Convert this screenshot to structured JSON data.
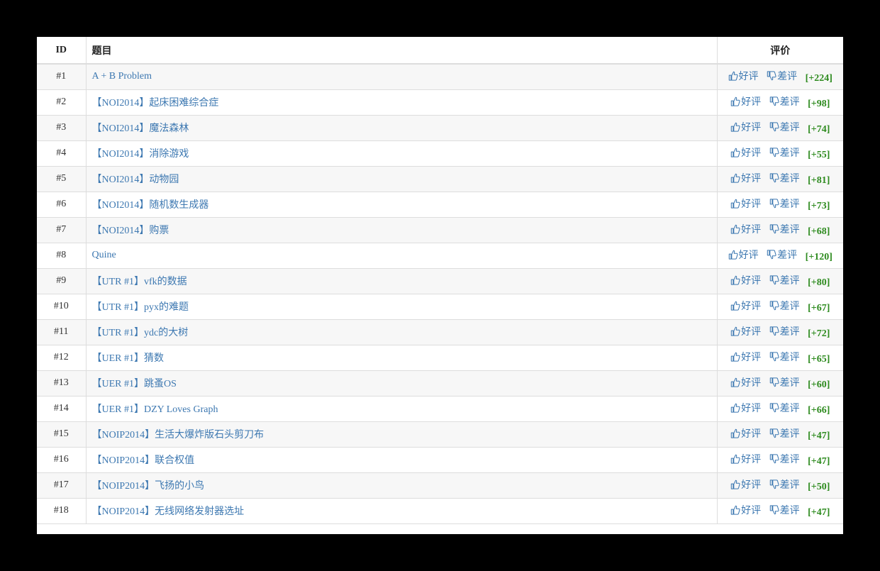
{
  "table": {
    "headers": {
      "id": "ID",
      "title": "题目",
      "rating": "评价"
    },
    "vote_labels": {
      "up": "好评",
      "down": "差评"
    },
    "icons": {
      "up": "thumbs-up-icon",
      "down": "thumbs-down-icon"
    },
    "colors": {
      "link": "#3d78b1",
      "score": "#2e8b1f"
    },
    "rows": [
      {
        "id": "#1",
        "title": "A + B Problem",
        "score": "[+224]"
      },
      {
        "id": "#2",
        "title": "【NOI2014】起床困难综合症",
        "score": "[+98]"
      },
      {
        "id": "#3",
        "title": "【NOI2014】魔法森林",
        "score": "[+74]"
      },
      {
        "id": "#4",
        "title": "【NOI2014】消除游戏",
        "score": "[+55]"
      },
      {
        "id": "#5",
        "title": "【NOI2014】动物园",
        "score": "[+81]"
      },
      {
        "id": "#6",
        "title": "【NOI2014】随机数生成器",
        "score": "[+73]"
      },
      {
        "id": "#7",
        "title": "【NOI2014】购票",
        "score": "[+68]"
      },
      {
        "id": "#8",
        "title": "Quine",
        "score": "[+120]"
      },
      {
        "id": "#9",
        "title": "【UTR #1】vfk的数据",
        "score": "[+80]"
      },
      {
        "id": "#10",
        "title": "【UTR #1】pyx的难题",
        "score": "[+67]"
      },
      {
        "id": "#11",
        "title": "【UTR #1】ydc的大树",
        "score": "[+72]"
      },
      {
        "id": "#12",
        "title": "【UER #1】猜数",
        "score": "[+65]"
      },
      {
        "id": "#13",
        "title": "【UER #1】跳蚤OS",
        "score": "[+60]"
      },
      {
        "id": "#14",
        "title": "【UER #1】DZY Loves Graph",
        "score": "[+66]"
      },
      {
        "id": "#15",
        "title": "【NOIP2014】生活大爆炸版石头剪刀布",
        "score": "[+47]"
      },
      {
        "id": "#16",
        "title": "【NOIP2014】联合权值",
        "score": "[+47]"
      },
      {
        "id": "#17",
        "title": "【NOIP2014】飞扬的小鸟",
        "score": "[+50]"
      },
      {
        "id": "#18",
        "title": "【NOIP2014】无线网络发射器选址",
        "score": "[+47]"
      }
    ]
  }
}
